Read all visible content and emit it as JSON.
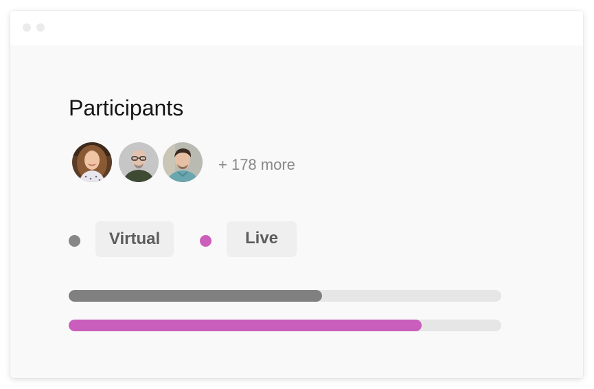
{
  "participants": {
    "title": "Participants",
    "more_label": "+ 178 more",
    "avatars": [
      {
        "icon": "avatar-woman-long-hair"
      },
      {
        "icon": "avatar-bald-man-glasses"
      },
      {
        "icon": "avatar-young-man-dark-hair"
      }
    ]
  },
  "legend": {
    "virtual": {
      "label": "Virtual",
      "color": "#878787"
    },
    "live": {
      "label": "Live",
      "color": "#cc5fbb"
    }
  },
  "bars": [
    {
      "series": "virtual",
      "fraction": 0.585,
      "color": "#808080"
    },
    {
      "series": "live",
      "fraction": 0.816,
      "color": "#c95ebc"
    }
  ],
  "window": {
    "title_dots": 2
  }
}
